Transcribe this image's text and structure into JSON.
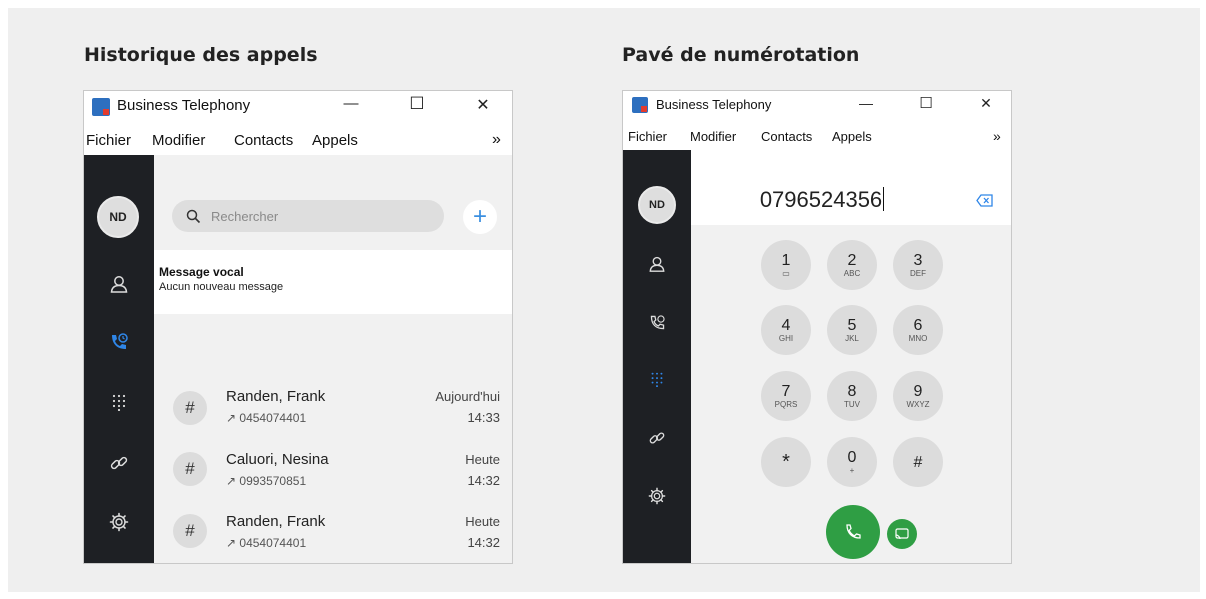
{
  "left_section": {
    "heading": "Historique des appels",
    "window": {
      "title": "Business Telephony",
      "minimize": "—",
      "maximize": "☐",
      "close": "✕",
      "menu": [
        "Fichier",
        "Modifier",
        "Contacts",
        "Appels"
      ],
      "menu_more": "»",
      "avatar": "ND",
      "search_placeholder": "Rechercher",
      "add": "+",
      "voicemail_title": "Message vocal",
      "voicemail_status": "Aucun nouveau message",
      "calls": [
        {
          "icon": "#",
          "name": "Randen, Frank",
          "number": "↗ 0454074401",
          "day": "Aujourd'hui",
          "time": "14:33"
        },
        {
          "icon": "#",
          "name": "Caluori, Nesina",
          "number": "↗ 0993570851",
          "day": "Heute",
          "time": "14:32"
        },
        {
          "icon": "#",
          "name": "Randen, Frank",
          "number": "↗ 0454074401",
          "day": "Heute",
          "time": "14:32"
        }
      ]
    }
  },
  "right_section": {
    "heading": "Pavé de numérotation",
    "window": {
      "title": "Business Telephony",
      "minimize": "—",
      "maximize": "☐",
      "close": "✕",
      "menu": [
        "Fichier",
        "Modifier",
        "Contacts",
        "Appels"
      ],
      "menu_more": "»",
      "avatar": "ND",
      "dialed_number": "0796524356",
      "keys": [
        {
          "digit": "1",
          "letters": "▭"
        },
        {
          "digit": "2",
          "letters": "ABC"
        },
        {
          "digit": "3",
          "letters": "DEF"
        },
        {
          "digit": "4",
          "letters": "GHI"
        },
        {
          "digit": "5",
          "letters": "JKL"
        },
        {
          "digit": "6",
          "letters": "MNO"
        },
        {
          "digit": "7",
          "letters": "PQRS"
        },
        {
          "digit": "8",
          "letters": "TUV"
        },
        {
          "digit": "9",
          "letters": "WXYZ"
        },
        {
          "digit": "*",
          "letters": ""
        },
        {
          "digit": "0",
          "letters": "+"
        },
        {
          "digit": "#",
          "letters": ""
        }
      ]
    }
  },
  "colors": {
    "sidebar": "#1e2024",
    "accent_blue": "#2f86e8",
    "call_green": "#2f9e44"
  }
}
